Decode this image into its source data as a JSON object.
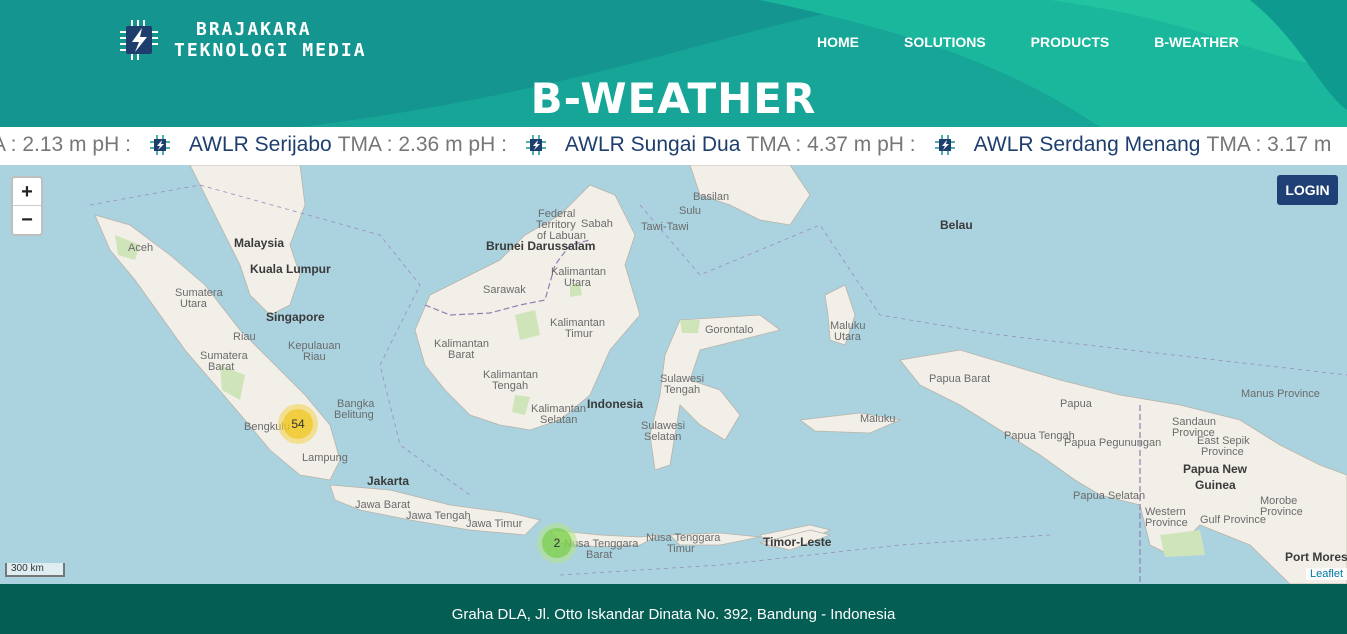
{
  "brand": {
    "line1": "BRAJAKARA",
    "line2": "TEKNOLOGI MEDIA",
    "logo_icon": "lightning-chip-icon"
  },
  "nav": {
    "items": [
      "HOME",
      "SOLUTIONS",
      "PRODUCTS",
      "B-WEATHER"
    ]
  },
  "page": {
    "title": "B-WEATHER"
  },
  "ticker": {
    "lead_text": "A : 2.13 m pH :",
    "items": [
      {
        "name": "AWLR Serijabo",
        "value": "TMA : 2.36 m pH :"
      },
      {
        "name": "AWLR Sungai Dua",
        "value": "TMA : 4.37 m pH :"
      },
      {
        "name": "AWLR Serdang Menang",
        "value": "TMA : 3.17 m"
      }
    ]
  },
  "map": {
    "zoom_in": "+",
    "zoom_out": "−",
    "login_label": "LOGIN",
    "scale_label": "300 km",
    "attribution": "Leaflet",
    "clusters": [
      {
        "count": "54",
        "color": "#f1d357"
      },
      {
        "count": "2",
        "color": "#6ecc39"
      }
    ],
    "labels": {
      "malaysia": "Malaysia",
      "kuala_lumpur": "Kuala Lumpur",
      "singapore": "Singapore",
      "brunei": "Brunei Darussalam",
      "indonesia": "Indonesia",
      "jakarta": "Jakarta",
      "belau": "Belau",
      "timor_leste": "Timor-Leste",
      "png": "Papua New",
      "png2": "Guinea",
      "port_moresby": "Port Moresb",
      "aceh": "Aceh",
      "sumatera_utara": "Sumatera",
      "sumatera_utara2": "Utara",
      "riau": "Riau",
      "kepulauan_riau": "Kepulauan",
      "kepulauan_riau2": "Riau",
      "sumatera_barat": "Sumatera",
      "sumatera_barat2": "Barat",
      "bangka": "Bangka",
      "bangka2": "Belitung",
      "bengkulu": "Bengkulu",
      "lampung": "Lampung",
      "sarawak": "Sarawak",
      "sabah": "Sabah",
      "kalbar": "Kalimantan",
      "kalbar2": "Barat",
      "kalteng": "Kalimantan",
      "kalteng2": "Tengah",
      "kalsel": "Kalimantan",
      "kalsel2": "Selatan",
      "kaltim": "Kalimantan",
      "kaltim2": "Timur",
      "kalut": "Kalimantan",
      "kalut2": "Utara",
      "sulteng": "Sulawesi",
      "sulteng2": "Tengah",
      "sulsel": "Sulawesi",
      "sulsel2": "Selatan",
      "gorontalo": "Gorontalo",
      "malut": "Maluku",
      "malut2": "Utara",
      "maluku": "Maluku",
      "papua_barat": "Papua Barat",
      "papua": "Papua",
      "papua_tengah": "Papua Tengah",
      "papua_pegunungan": "Papua Pegunungan",
      "papua_selatan": "Papua Selatan",
      "jawa_barat": "Jawa Barat",
      "jawa_tengah": "Jawa Tengah",
      "jawa_timur": "Jawa Timur",
      "ntb": "Nusa Tenggara",
      "ntb2": "Barat",
      "ntt": "Nusa Tenggara",
      "ntt2": "Timur",
      "manus": "Manus Province",
      "sandaun": "Sandaun",
      "sandaun2": "Province",
      "east_sepik": "East Sepik",
      "east_sepik2": "Province",
      "western": "Western",
      "western2": "Province",
      "gulf": "Gulf Province",
      "morobe": "Morobe",
      "morobe2": "Province",
      "tawi": "Tawi-Tawi",
      "sulu": "Sulu",
      "basilan": "Basilan",
      "labuan": "Federal",
      "labuan2": "Territory",
      "labuan3": "of Labuan"
    }
  },
  "footer": {
    "address": "Graha DLA, Jl. Otto Iskandar Dinata No. 392, Bandung - Indonesia"
  }
}
